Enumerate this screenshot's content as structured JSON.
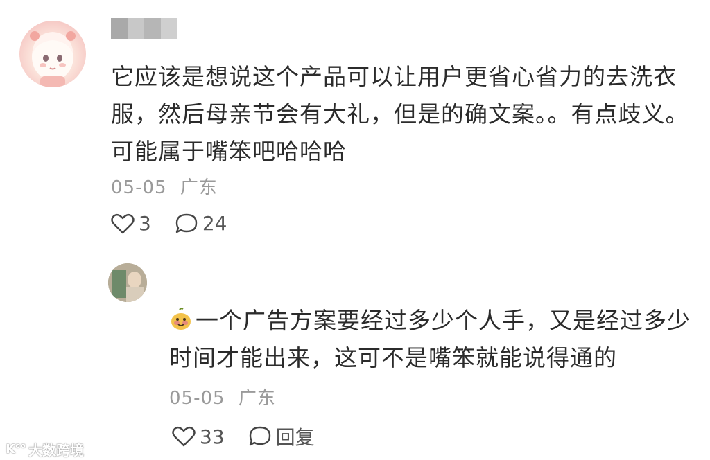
{
  "comment": {
    "text": "它应该是想说这个产品可以让用户更省心省力的去洗衣服，然后母亲节会有大礼，但是的确文案。。有点歧义。可能属于嘴笨吧哈哈哈",
    "date": "05-05",
    "location": "广东",
    "likes": "3",
    "replies": "24"
  },
  "reply": {
    "text": "一个广告方案要经过多少个人手，又是经过多少时间才能出来，这可不是嘴笨就能说得通的",
    "date": "05-05",
    "location": "广东",
    "likes": "33",
    "reply_label": "回复"
  },
  "watermark": {
    "logo": "K°°",
    "text": "大数跨境"
  }
}
